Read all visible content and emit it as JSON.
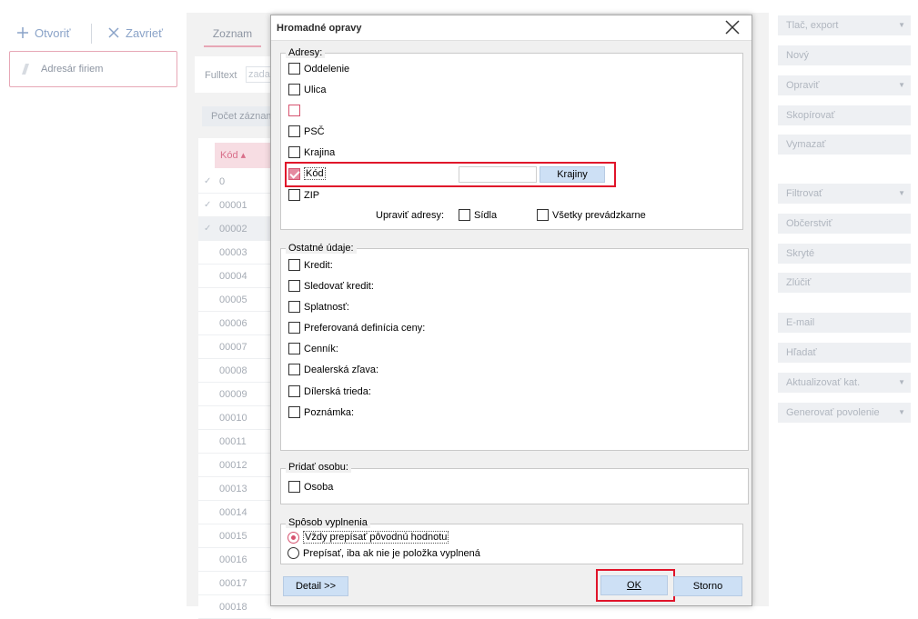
{
  "toolbar": {
    "open_label": "Otvoriť",
    "close_label": "Zavrieť"
  },
  "left_nav": {
    "item_label": "Adresár firiem"
  },
  "list": {
    "tab_label": "Zoznam",
    "fulltext_label": "Fulltext",
    "fulltext_placeholder": "zadaj",
    "count_button": "Počet záznamov",
    "column_header": "Kód",
    "rows": [
      "0",
      "00001",
      "00002",
      "00003",
      "00004",
      "00005",
      "00006",
      "00007",
      "00008",
      "00009",
      "00010",
      "00011",
      "00012",
      "00013",
      "00014",
      "00015",
      "00016",
      "00017",
      "00018"
    ],
    "checked_rows": [
      0,
      1,
      2
    ]
  },
  "right_panel": {
    "buttons": [
      {
        "label": "Tlač, export",
        "dropdown": true
      },
      {
        "label": "Nový",
        "dropdown": false
      },
      {
        "label": "Opraviť",
        "dropdown": true
      },
      {
        "label": "Skopírovať",
        "dropdown": false
      },
      {
        "label": "Vymazať",
        "dropdown": false
      },
      {
        "label": "Filtrovať",
        "dropdown": true
      },
      {
        "label": "Občerstviť",
        "dropdown": false
      },
      {
        "label": "Skryté",
        "dropdown": false
      },
      {
        "label": "Zlúčiť",
        "dropdown": false
      },
      {
        "label": "E-mail",
        "dropdown": false
      },
      {
        "label": "Hľadať",
        "dropdown": false
      },
      {
        "label": "Aktualizovať kat.",
        "dropdown": true
      },
      {
        "label": "Generovať povolenie",
        "dropdown": true
      }
    ]
  },
  "dialog": {
    "title": "Hromadné opravy",
    "addresses": {
      "label": "Adresy:",
      "items": [
        "Oddelenie",
        "Ulica",
        "",
        "PSČ",
        "Krajina",
        "Kód",
        "ZIP"
      ],
      "kod_button": "Krajiny",
      "kod_value": "",
      "adjust_label": "Upraviť adresy:",
      "option_sidla": "Sídla",
      "option_all": "Všetky prevádzkarne"
    },
    "other": {
      "label": "Ostatné údaje:",
      "items": [
        "Kredit:",
        "Sledovať kredit:",
        "Splatnosť:",
        "Preferovaná definícia ceny:",
        "Cenník:",
        "Dealerská zľava:",
        "Dílerská trieda:",
        "Poznámka:"
      ]
    },
    "person": {
      "label": "Pridať osobu:",
      "item": "Osoba"
    },
    "fill_mode": {
      "label": "Spôsob vyplnenia",
      "option_always": "Vždy prepísať pôvodnú hodnotu",
      "option_empty": "Prepísať, iba ak nie je položka vyplnená",
      "selected": "always"
    },
    "detail_button": "Detail >>",
    "ok_button": "OK",
    "cancel_button": "Storno"
  },
  "colors": {
    "accent_pink": "#d6536f",
    "highlight_red": "#e0142a",
    "button_blue": "#cde0f5"
  }
}
